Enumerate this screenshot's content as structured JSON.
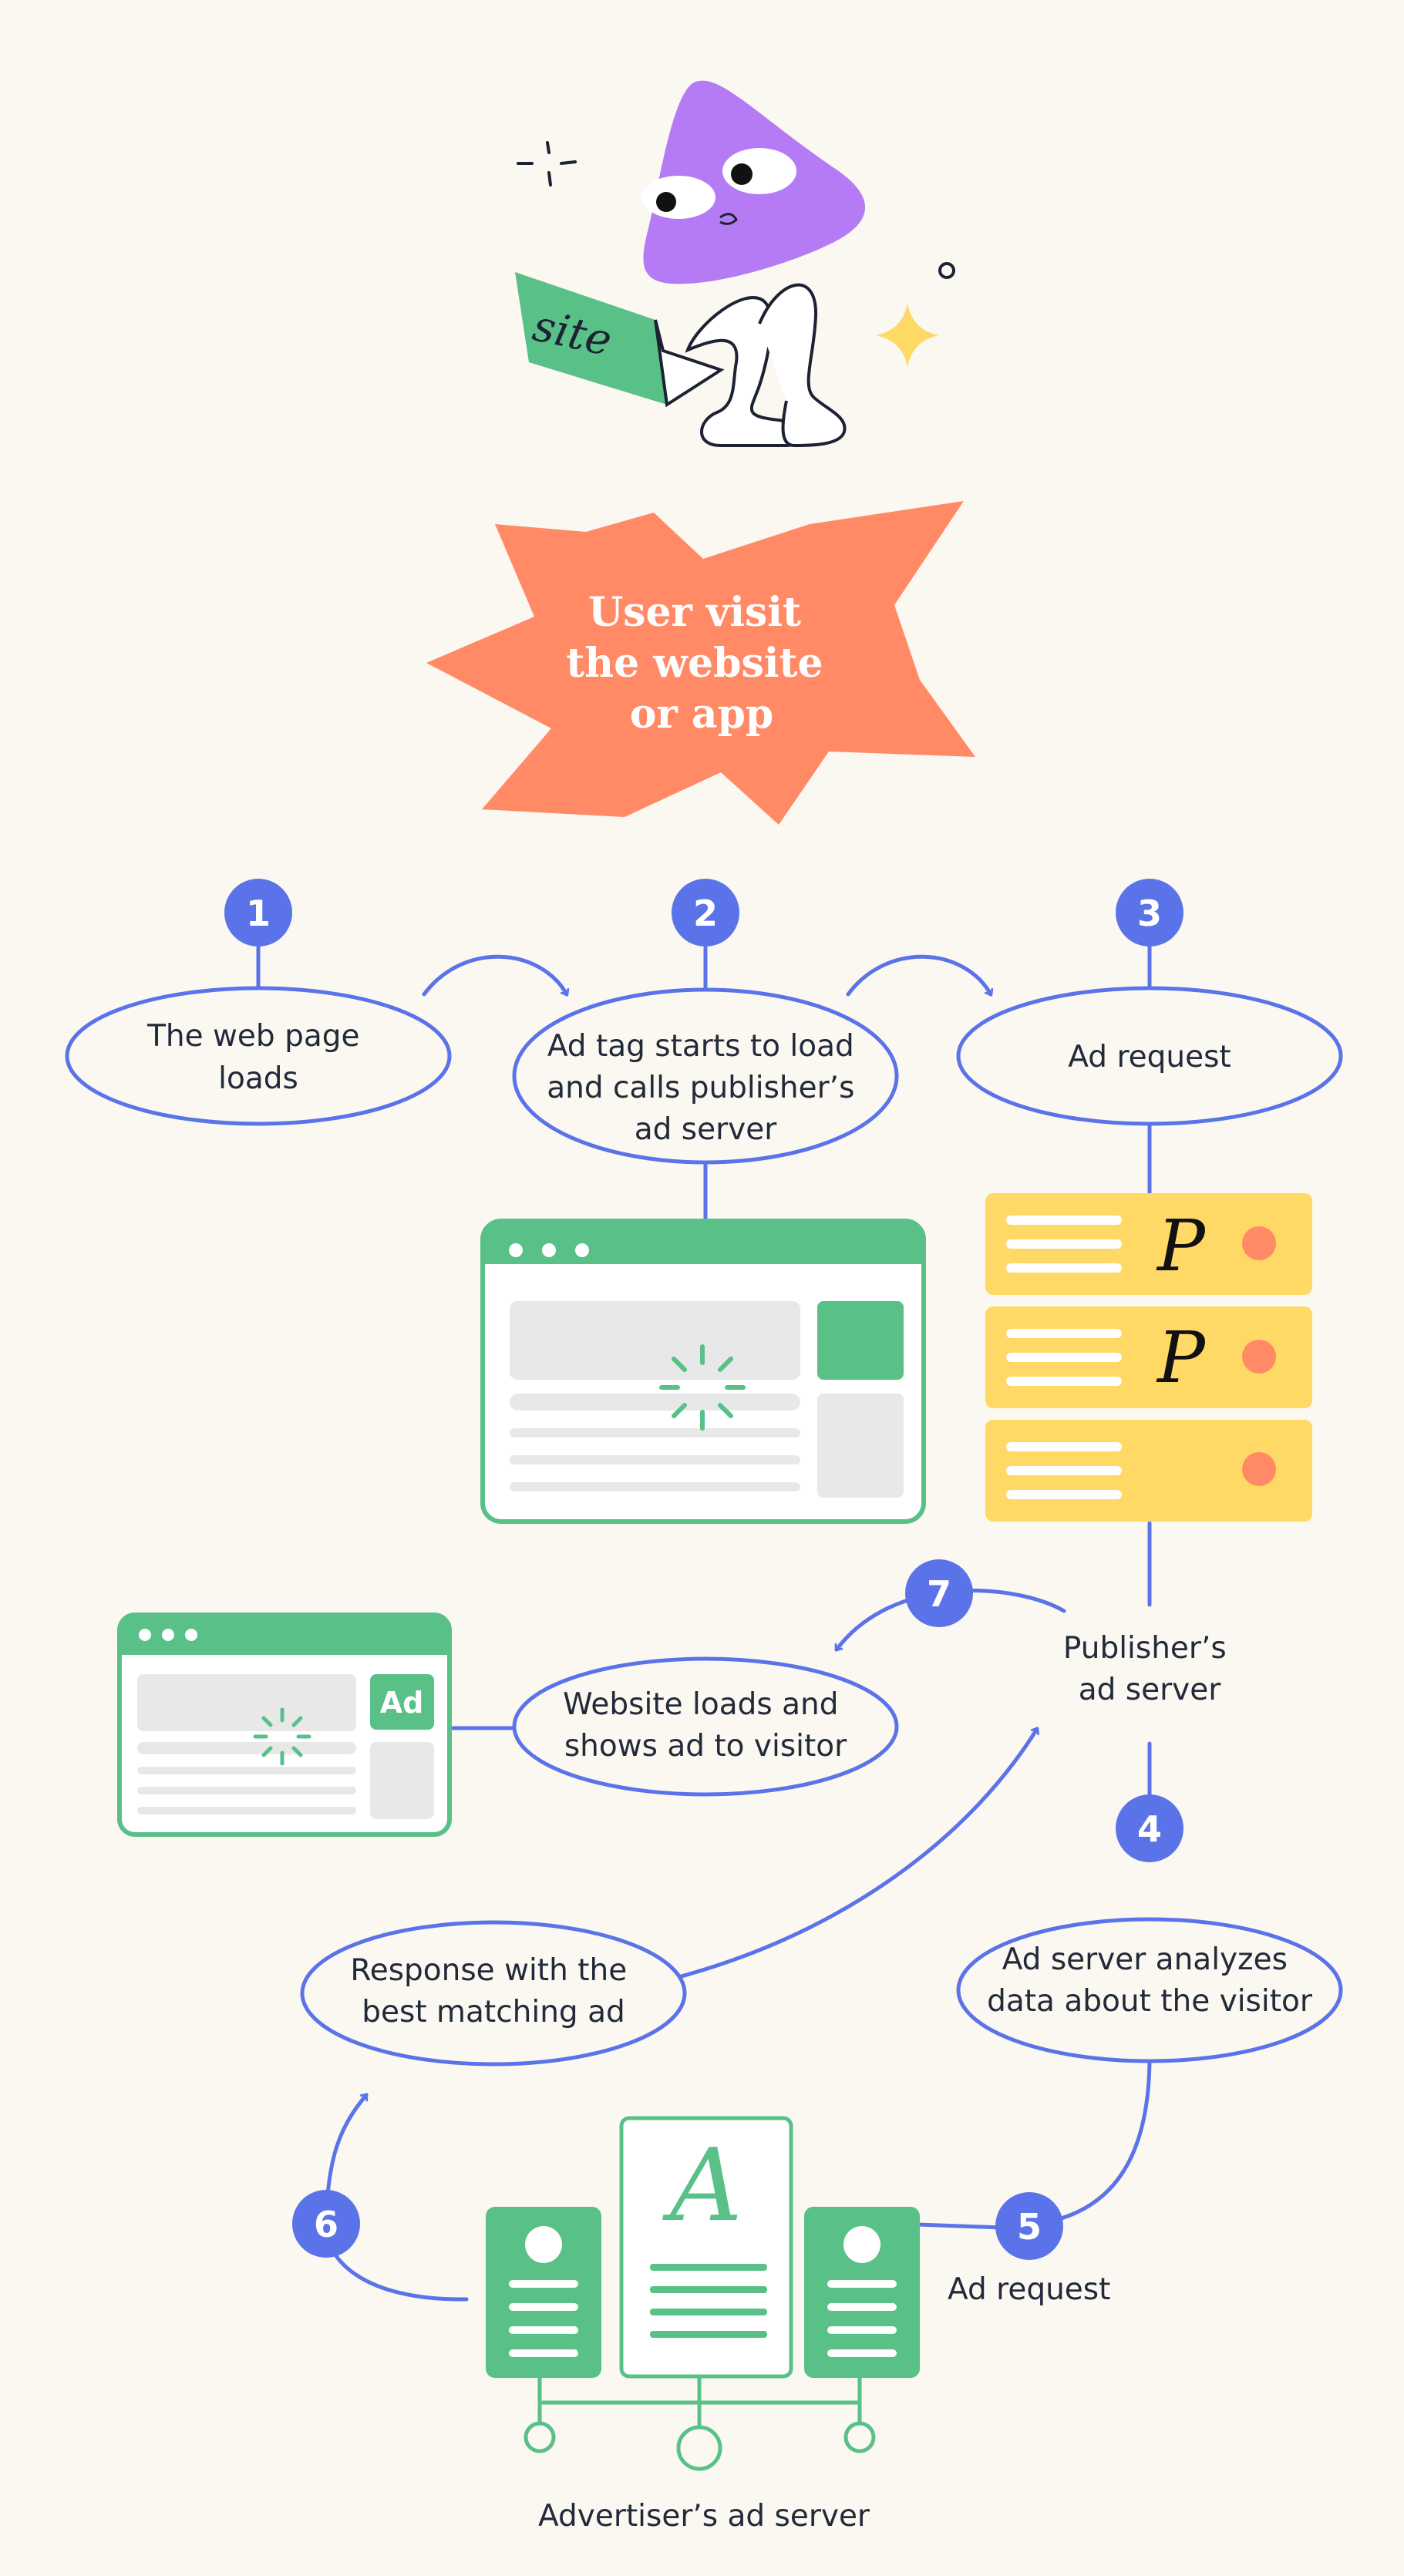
{
  "title": [
    "User visit",
    "the website",
    "or app"
  ],
  "character": {
    "laptop_text": "site"
  },
  "steps": {
    "s1": {
      "number": "1",
      "lines": [
        "The web page",
        "loads"
      ]
    },
    "s2": {
      "number": "2",
      "lines": [
        "Ad tag starts to load",
        "and calls publisher’s",
        "ad server"
      ]
    },
    "s3": {
      "number": "3",
      "lines": [
        "Ad request"
      ]
    },
    "s4": {
      "number": "4",
      "lines": [
        "Ad server analyzes",
        "data about the visitor"
      ]
    },
    "s5": {
      "number": "5",
      "label": "Ad request"
    },
    "s6": {
      "number": "6",
      "lines": [
        "Response with the",
        "best matching ad"
      ]
    },
    "s7": {
      "number": "7",
      "lines": [
        "Website loads and",
        "shows ad to visitor"
      ]
    }
  },
  "publisher_server": {
    "lines": [
      "Publisher’s",
      "ad server"
    ],
    "marks": [
      "P",
      "P"
    ]
  },
  "advertiser_server": {
    "label": "Advertiser’s ad server",
    "letter": "A"
  },
  "browser_ad_badge": "Ad",
  "colors": {
    "background": "#FBF8F1",
    "accent_blue": "#5B73E8",
    "green": "#59C088",
    "orange_burst": "#FF8A65",
    "yellow_server": "#FFD966",
    "purple_character": "#B57BF5",
    "orange_dot": "#FF8A65"
  }
}
